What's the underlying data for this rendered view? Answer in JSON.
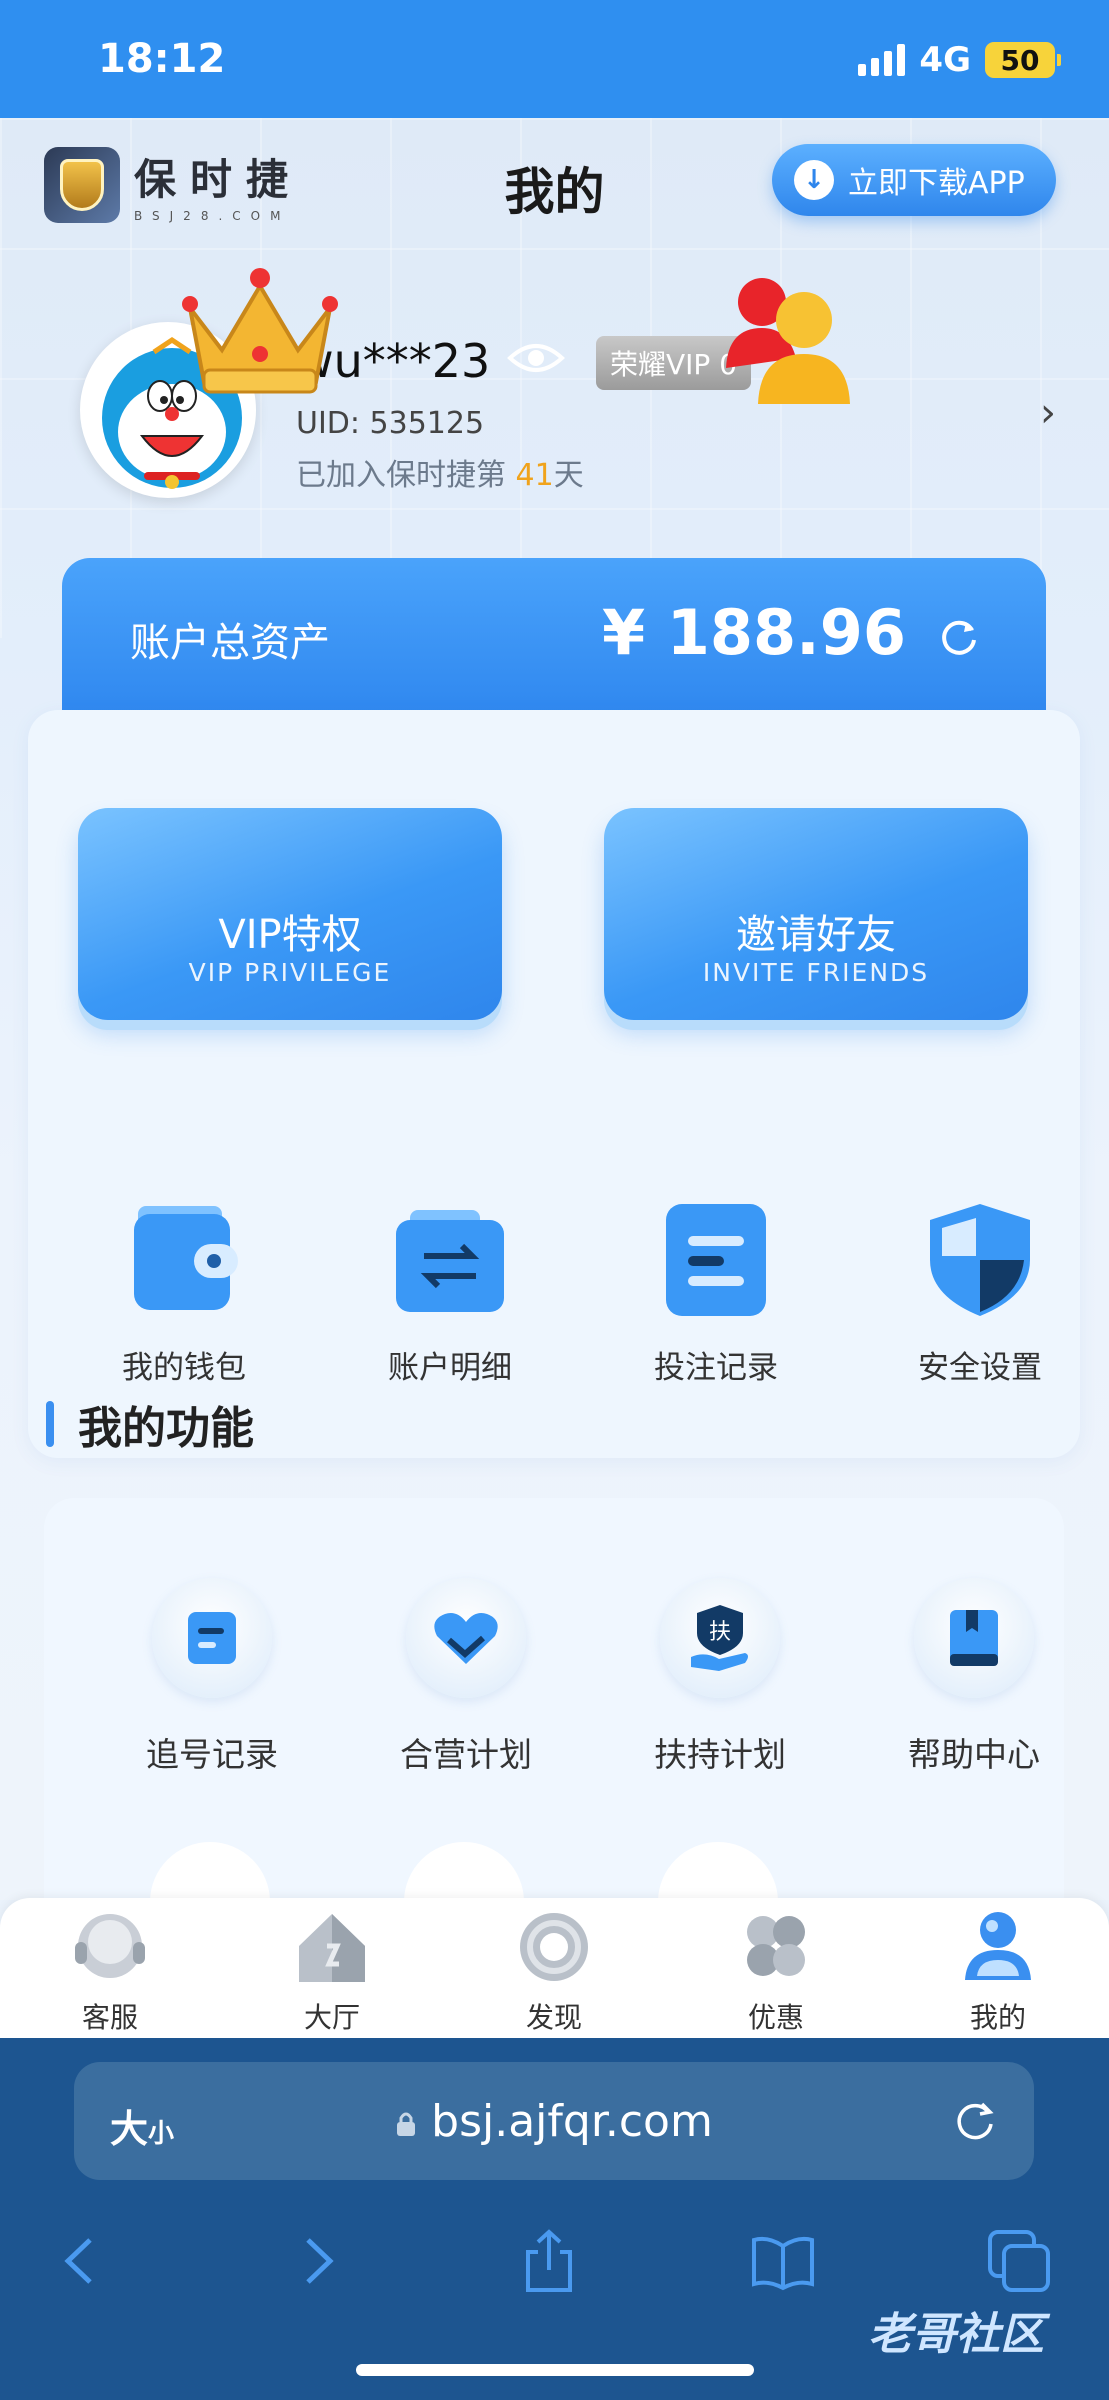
{
  "status": {
    "time": "18:12",
    "network": "4G",
    "battery": "50"
  },
  "header": {
    "logo_text": "保时捷",
    "logo_sub": "BSJ28.COM",
    "title": "我的",
    "download_label": "立即下载APP"
  },
  "profile": {
    "username": "wu***23",
    "vip_level": "荣耀VIP 0",
    "uid": "UID: 535125",
    "joined_prefix": "已加入保时捷第 ",
    "joined_days": "41",
    "joined_suffix": "天"
  },
  "assets": {
    "label": "账户总资产",
    "value": "¥ 188.96"
  },
  "promos": [
    {
      "title": "VIP特权",
      "subtitle": "VIP PRIVILEGE"
    },
    {
      "title": "邀请好友",
      "subtitle": "INVITE FRIENDS"
    }
  ],
  "quick_actions": [
    {
      "label": "我的钱包",
      "icon": "wallet-icon"
    },
    {
      "label": "账户明细",
      "icon": "transfer-folder-icon"
    },
    {
      "label": "投注记录",
      "icon": "record-icon"
    },
    {
      "label": "安全设置",
      "icon": "shield-icon"
    }
  ],
  "functions": {
    "title": "我的功能",
    "items": [
      {
        "label": "追号记录",
        "icon": "note-icon"
      },
      {
        "label": "合营计划",
        "icon": "handshake-icon"
      },
      {
        "label": "扶持计划",
        "icon": "support-hand-icon",
        "badge": "扶"
      },
      {
        "label": "帮助中心",
        "icon": "book-icon"
      }
    ]
  },
  "tabs": [
    {
      "label": "客服",
      "icon": "customer-service-icon"
    },
    {
      "label": "大厅",
      "icon": "house-icon"
    },
    {
      "label": "发现",
      "icon": "discover-icon"
    },
    {
      "label": "优惠",
      "icon": "clover-icon"
    },
    {
      "label": "我的",
      "icon": "user-icon",
      "active": true
    }
  ],
  "browser": {
    "text_size_big": "大",
    "text_size_small": "小",
    "url": "bsj.ajfqr.com"
  },
  "watermark": "老哥社区"
}
